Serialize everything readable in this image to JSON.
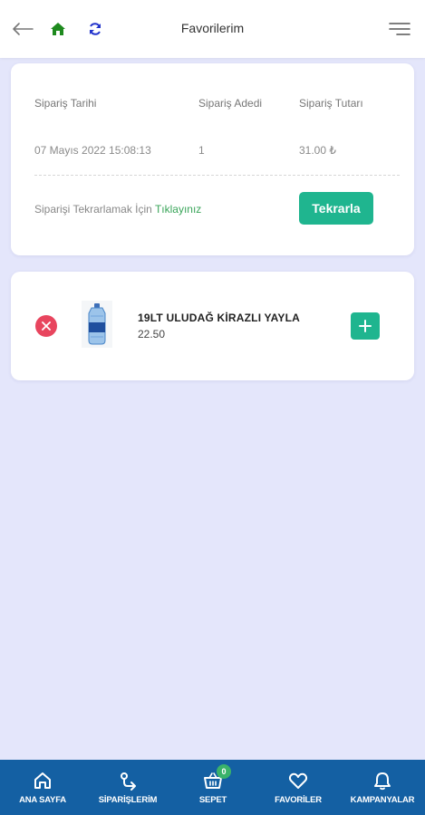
{
  "header": {
    "title": "Favorilerim"
  },
  "order": {
    "date_label": "Sipariş Tarihi",
    "count_label": "Sipariş Adedi",
    "total_label": "Sipariş Tutarı",
    "date_value": "07 Mayıs 2022 15:08:13",
    "count_value": "1",
    "total_value": "31.00 ₺",
    "repeat_text": "Siparişi Tekrarlamak İçin ",
    "repeat_link": "Tıklayınız",
    "repeat_button": "Tekrarla"
  },
  "product": {
    "name": "19LT ULUDAĞ KİRAZLI YAYLA",
    "price": "22.50"
  },
  "bottom_nav": {
    "items": [
      {
        "label": "ANA SAYFA",
        "icon": "home-icon"
      },
      {
        "label": "SİPARİŞLERİM",
        "icon": "orders-icon"
      },
      {
        "label": "SEPET",
        "icon": "basket-icon",
        "badge": "0"
      },
      {
        "label": "FAVORİLER",
        "icon": "heart-icon"
      },
      {
        "label": "KAMPANYALAR",
        "icon": "bell-icon"
      }
    ]
  },
  "colors": {
    "accent_green": "#1fb58f",
    "nav_blue": "#1460a3",
    "remove_red": "#e8455e",
    "background": "#e4e6fb"
  }
}
